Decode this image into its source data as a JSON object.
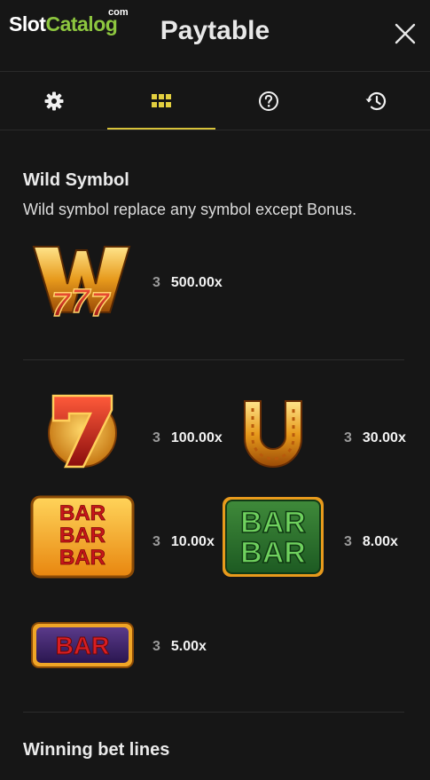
{
  "brand": {
    "logo_slot": "Slot",
    "logo_catalog": "Catalog",
    "logo_com": "com"
  },
  "header": {
    "title": "Paytable"
  },
  "tabs": [
    {
      "name": "settings",
      "icon": "gear-icon"
    },
    {
      "name": "paytable",
      "icon": "grid-icon",
      "active": true
    },
    {
      "name": "help",
      "icon": "question-icon"
    },
    {
      "name": "history",
      "icon": "history-icon"
    }
  ],
  "wild": {
    "title": "Wild Symbol",
    "description": "Wild symbol replace any symbol except Bonus.",
    "pay": {
      "count": "3",
      "multiplier": "500.00x"
    }
  },
  "symbols": [
    {
      "name": "seven",
      "count": "3",
      "multiplier": "100.00x"
    },
    {
      "name": "horseshoe",
      "count": "3",
      "multiplier": "30.00x"
    },
    {
      "name": "triple-bar",
      "count": "3",
      "multiplier": "10.00x",
      "label": "BAR"
    },
    {
      "name": "double-bar",
      "count": "3",
      "multiplier": "8.00x",
      "label": "BAR"
    },
    {
      "name": "single-bar",
      "count": "3",
      "multiplier": "5.00x",
      "label": "BAR"
    }
  ],
  "footer": {
    "title": "Winning bet lines"
  },
  "colors": {
    "accent": "#d7c23a",
    "brand_green": "#8dc63f",
    "background": "#161616"
  }
}
